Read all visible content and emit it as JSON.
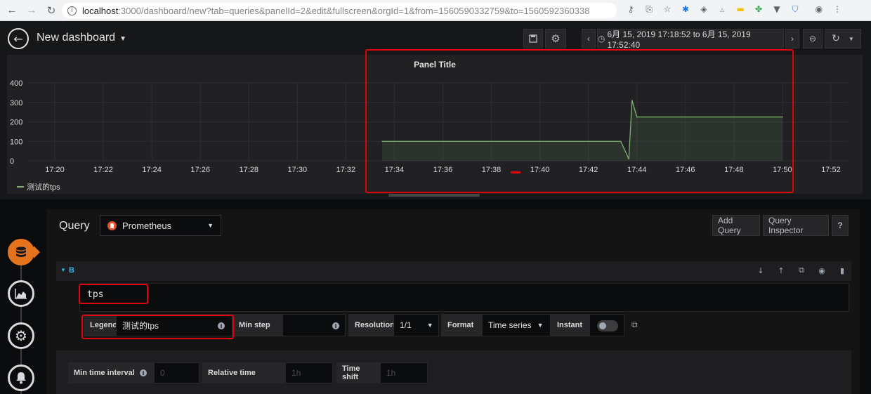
{
  "browser": {
    "url_host": "localhost",
    "url_path": ":3000/dashboard/new?tab=queries&panelId=2&edit&fullscreen&orgId=1&from=1560590332759&to=1560592360338"
  },
  "navbar": {
    "title": "New dashboard",
    "time_range": "6月 15, 2019 17:18:52 to 6月 15, 2019 17:52:40"
  },
  "panel": {
    "title": "Panel Title"
  },
  "chart_data": {
    "type": "line",
    "title": "Panel Title",
    "y_ticks": [
      "400",
      "300",
      "200",
      "100",
      "0"
    ],
    "x_ticks": [
      "17:20",
      "17:22",
      "17:24",
      "17:26",
      "17:28",
      "17:30",
      "17:32",
      "17:34",
      "17:36",
      "17:38",
      "17:40",
      "17:42",
      "17:44",
      "17:46",
      "17:48",
      "17:50",
      "17:52"
    ],
    "ylim": [
      0,
      400
    ],
    "grid": true,
    "legend_position": "bottom-left",
    "series": [
      {
        "name": "测试的tps",
        "color": "#7eb26d",
        "x": [
          "17:33:30",
          "17:43:20",
          "17:43:40",
          "17:43:48",
          "17:44:00",
          "17:50:00"
        ],
        "values": [
          100,
          100,
          10,
          310,
          225,
          225
        ]
      }
    ]
  },
  "editor": {
    "query_label": "Query",
    "datasource": "Prometheus",
    "add_query": "Add Query",
    "query_inspector": "Query Inspector",
    "help": "?",
    "ref_id": "B",
    "expression": "tps",
    "legend_label": "Legend",
    "legend_value": "测试的tps",
    "min_step_label": "Min step",
    "min_step_value": "",
    "resolution_label": "Resolution",
    "resolution_value": "1/1",
    "format_label": "Format",
    "format_value": "Time series",
    "instant_label": "Instant",
    "min_time_interval_label": "Min time interval",
    "min_time_interval_placeholder": "0",
    "relative_time_label": "Relative time",
    "relative_time_placeholder": "1h",
    "time_shift_label": "Time shift",
    "time_shift_placeholder": "1h"
  }
}
